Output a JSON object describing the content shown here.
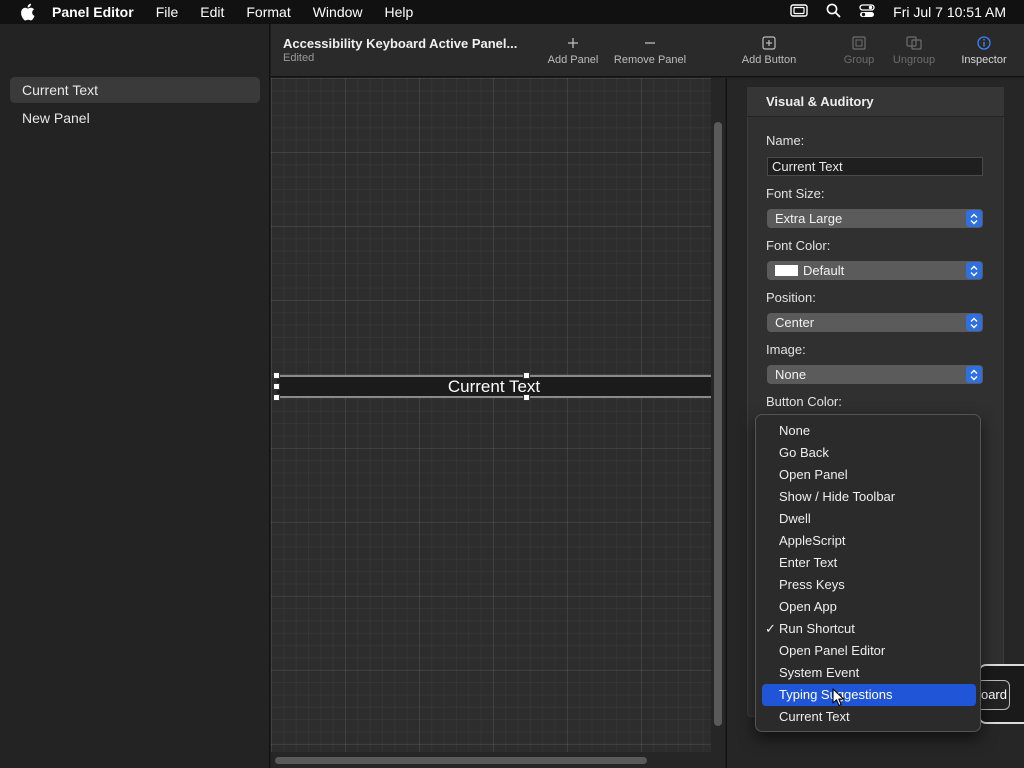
{
  "menubar": {
    "app_name": "Panel Editor",
    "menus": [
      "File",
      "Edit",
      "Format",
      "Window",
      "Help"
    ],
    "clock": "Fri Jul 7  10:51 AM"
  },
  "sidebar": {
    "items": [
      {
        "label": "Current Text",
        "selected": true
      },
      {
        "label": "New Panel",
        "selected": false
      }
    ]
  },
  "toolbar": {
    "doc_title": "Accessibility Keyboard Active Panel...",
    "doc_status": "Edited",
    "buttons": {
      "add_panel": "Add Panel",
      "remove_panel": "Remove Panel",
      "add_button": "Add Button",
      "group": "Group",
      "ungroup": "Ungroup",
      "inspector": "Inspector"
    }
  },
  "canvas": {
    "element_text": "Current Text"
  },
  "inspector": {
    "section_title": "Visual & Auditory",
    "name_label": "Name:",
    "name_value": "Current Text",
    "font_size_label": "Font Size:",
    "font_size_value": "Extra Large",
    "font_color_label": "Font Color:",
    "font_color_value": "Default",
    "position_label": "Position:",
    "position_value": "Center",
    "image_label": "Image:",
    "image_value": "None",
    "button_color_label": "Button Color:",
    "partial_button_text": "oard"
  },
  "dropdown": {
    "items": [
      {
        "label": "None",
        "checked": false,
        "highlighted": false
      },
      {
        "label": "Go Back",
        "checked": false,
        "highlighted": false
      },
      {
        "label": "Open Panel",
        "checked": false,
        "highlighted": false
      },
      {
        "label": "Show / Hide Toolbar",
        "checked": false,
        "highlighted": false
      },
      {
        "label": "Dwell",
        "checked": false,
        "highlighted": false
      },
      {
        "label": "AppleScript",
        "checked": false,
        "highlighted": false
      },
      {
        "label": "Enter Text",
        "checked": false,
        "highlighted": false
      },
      {
        "label": "Press Keys",
        "checked": false,
        "highlighted": false
      },
      {
        "label": "Open App",
        "checked": false,
        "highlighted": false
      },
      {
        "label": "Run Shortcut",
        "checked": true,
        "highlighted": false
      },
      {
        "label": "Open Panel Editor",
        "checked": false,
        "highlighted": false
      },
      {
        "label": "System Event",
        "checked": false,
        "highlighted": false
      },
      {
        "label": "Typing Suggestions",
        "checked": false,
        "highlighted": true
      },
      {
        "label": "Current Text",
        "checked": false,
        "highlighted": false
      }
    ],
    "check_glyph": "✓"
  },
  "colors": {
    "accent": "#1f55d6",
    "popup_chevron": "#2f6fe0"
  }
}
